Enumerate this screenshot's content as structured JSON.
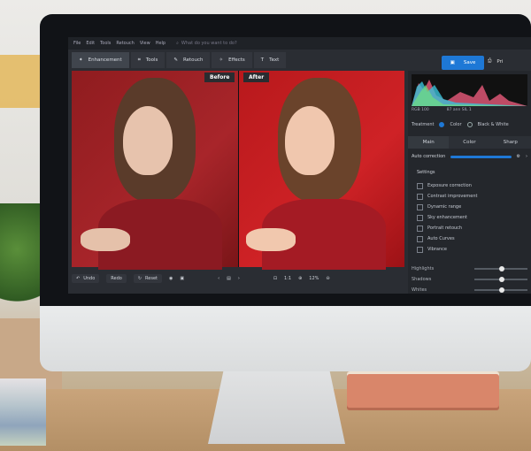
{
  "menubar": {
    "items": [
      "File",
      "Edit",
      "Tools",
      "Retouch",
      "View",
      "Help"
    ],
    "search_placeholder": "What do you want to do?"
  },
  "toolbar": {
    "tools": [
      {
        "label": "Enhancement",
        "icon": "enhance-icon"
      },
      {
        "label": "Tools",
        "icon": "crop-icon"
      },
      {
        "label": "Retouch",
        "icon": "brush-icon"
      },
      {
        "label": "Effects",
        "icon": "wand-icon"
      },
      {
        "label": "Text",
        "icon": "text-icon"
      }
    ],
    "save_label": "Save",
    "print_label": "Pri"
  },
  "compare": {
    "before_label": "Before",
    "after_label": "After"
  },
  "bottom": {
    "undo_label": "Undo",
    "redo_label": "Redo",
    "reset_label": "Reset",
    "zoom_ratio": "1:1",
    "zoom_percent": "12%"
  },
  "panel": {
    "hist_left": "RGB 100",
    "hist_right": "87 ann SIL 1",
    "treatment_label": "Treatment",
    "color_label": "Color",
    "bw_label": "Black & White",
    "tabs": [
      "Main",
      "Color",
      "Sharp"
    ],
    "auto_correction": "Auto correction",
    "settings_title": "Settings",
    "checks": [
      "Exposure correction",
      "Contrast improvement",
      "Dynamic range",
      "Sky enhancement",
      "Portrait retouch",
      "Auto Curves",
      "Vibrance"
    ],
    "sliders": [
      "Highlights",
      "Shadows",
      "Whites"
    ]
  },
  "colors": {
    "accent": "#1e78d6",
    "red_bg": "#cf2226"
  }
}
